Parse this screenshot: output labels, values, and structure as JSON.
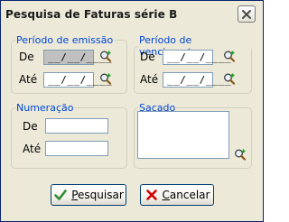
{
  "window": {
    "title": "Pesquisa de Faturas série B"
  },
  "emissao": {
    "legend": "Período de emissão",
    "de_label": "De",
    "ate_label": "Até",
    "de_value": "__/__/____",
    "ate_value": "__/__/____"
  },
  "vencimento": {
    "legend": "Período de vencimento",
    "de_label": "De",
    "ate_label": "Até",
    "de_value": "__/__/____",
    "ate_value": "__/__/____"
  },
  "numeracao": {
    "legend": "Numeração",
    "de_label": "De",
    "ate_label": "Até",
    "de_value": "",
    "ate_value": ""
  },
  "sacado": {
    "legend": "Sacado",
    "value": ""
  },
  "buttons": {
    "pesquisar_accel": "P",
    "pesquisar_rest": "esquisar",
    "cancelar_accel": "C",
    "cancelar_rest": "ancelar"
  },
  "colors": {
    "legend": "#0046d5",
    "ok_check": "#2e8b2e",
    "cancel_x": "#d40000"
  }
}
